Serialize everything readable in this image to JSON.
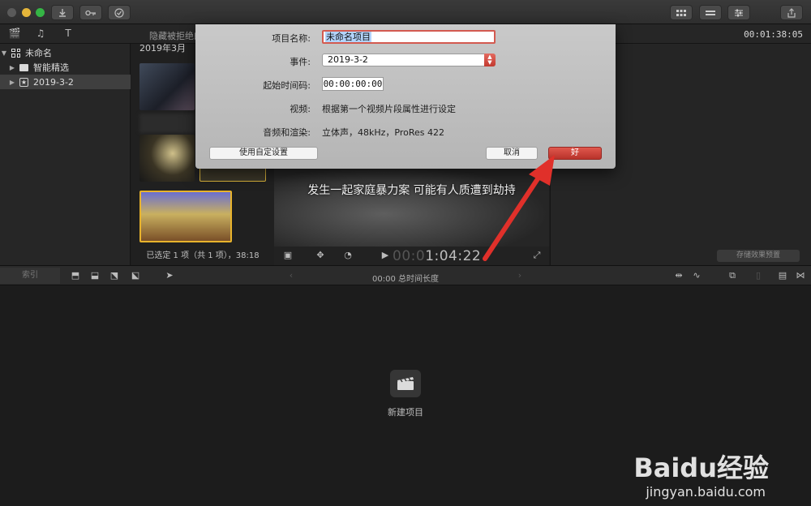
{
  "titlebar": {
    "share_icon": "share-icon"
  },
  "library_bar": {
    "hidden_label": "隐藏被拒绝的",
    "timecode": "00:01:38:05"
  },
  "sidebar": {
    "items": [
      {
        "label": "未命名",
        "icon": "library-grid-icon",
        "expanded": true
      },
      {
        "label": "智能精选",
        "icon": "folder-icon"
      },
      {
        "label": "2019-3-2",
        "icon": "event-star-icon",
        "selected": true
      }
    ]
  },
  "browser": {
    "date_header": "2019年3月",
    "status": "已选定 1 项（共 1 项），38:18"
  },
  "viewer": {
    "subtitle": "发生一起家庭暴力案 可能有人质遭到劫持",
    "timecode_dim": "00:0",
    "timecode_bright": "1:04:22"
  },
  "inspector": {
    "save_preset": "存储效果预置"
  },
  "timeline_bar": {
    "index_label": "索引",
    "center": "00:00 总时间长度"
  },
  "timeline": {
    "new_project": "新建项目"
  },
  "dialog": {
    "project_name_label": "项目名称:",
    "project_name_value": "未命名项目",
    "event_label": "事件:",
    "event_value": "2019-3-2",
    "start_tc_label": "起始时间码:",
    "start_tc_value": "00:00:00:00",
    "video_label": "视频:",
    "video_value": "根据第一个视频片段属性进行设定",
    "audio_label": "音频和渲染:",
    "audio_value": "立体声，48kHz，ProRes 422",
    "custom_button": "使用自定设置",
    "cancel_button": "取消",
    "ok_button": "好"
  },
  "watermark": {
    "brand": "Baidu经验",
    "url": "jingyan.baidu.com"
  },
  "colors": {
    "accent_red": "#c2392f",
    "arrow_red": "#e0302a"
  }
}
